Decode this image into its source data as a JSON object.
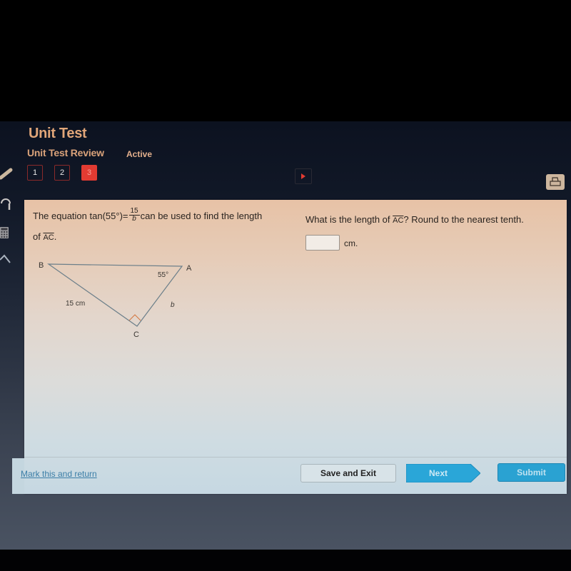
{
  "header": {
    "title": "Unit Test",
    "subtitle": "Unit Test Review",
    "status": "Active",
    "question_nav": [
      {
        "label": "1",
        "current": false
      },
      {
        "label": "2",
        "current": false
      },
      {
        "label": "3",
        "current": true
      }
    ],
    "icons": {
      "next_question": "play-arrow-icon",
      "print": "print-icon"
    }
  },
  "tools": [
    "pencil-icon",
    "headphones-icon",
    "calculator-icon",
    "pointer-icon"
  ],
  "question": {
    "text_part1": "The equation tan(55°)=",
    "fraction_numerator": "15",
    "fraction_denominator": "b",
    "text_part2": "can be used to find the length",
    "text_line2_prefix": "of ",
    "segment": "AC",
    "text_line2_suffix": "."
  },
  "diagram": {
    "vertices": {
      "A": "A",
      "B": "B",
      "C": "C"
    },
    "angle_label": "55°",
    "side_bc_label": "15 cm",
    "side_ac_label": "b",
    "right_angle_at": "C"
  },
  "answer": {
    "prompt_prefix": "What is the length of ",
    "segment": "AC",
    "prompt_suffix": "? Round to the nearest tenth.",
    "input_value": "",
    "input_placeholder": "",
    "unit": "cm."
  },
  "footer": {
    "mark_link": "Mark this and return",
    "save_exit": "Save and Exit",
    "next": "Next",
    "submit": "Submit"
  },
  "colors": {
    "title": "#e1a679",
    "current_question": "#e23b32",
    "primary_button": "#2aa2d2",
    "link": "#3b7ea7"
  }
}
